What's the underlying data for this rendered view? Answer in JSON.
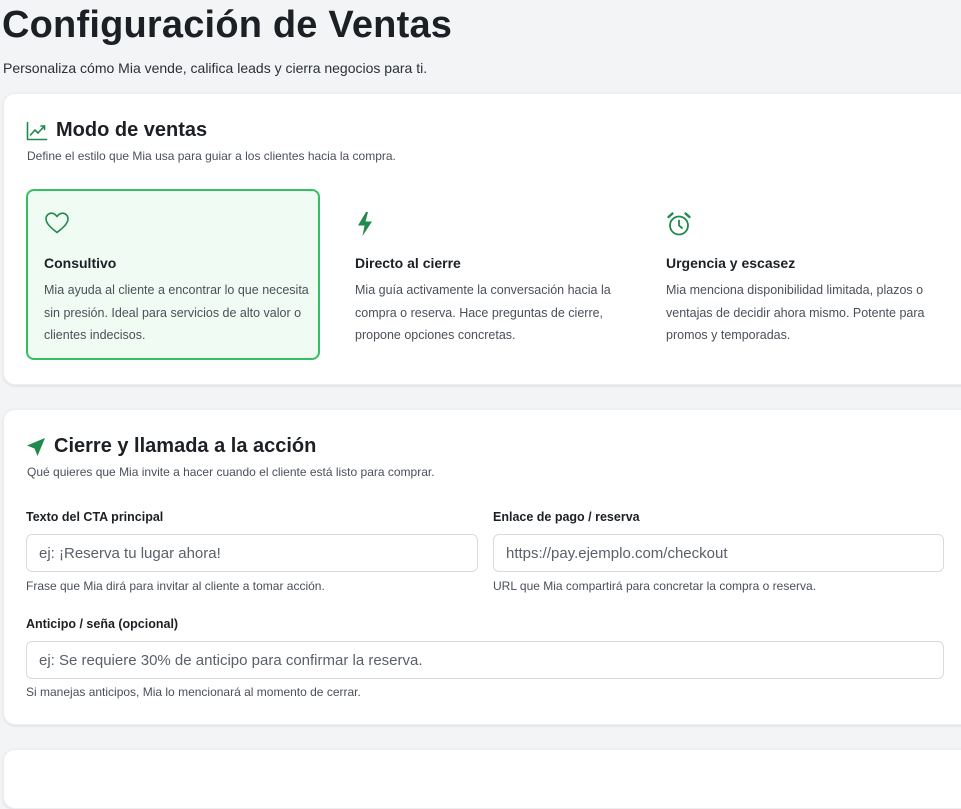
{
  "page": {
    "title": "Configuración de Ventas",
    "subtitle": "Personaliza cómo Mia vende, califica leads y cierra negocios para ti."
  },
  "sales_mode": {
    "icon": "trending-up-icon",
    "title": "Modo de ventas",
    "description": "Define el estilo que Mia usa para guiar a los clientes hacia la compra.",
    "options": [
      {
        "icon": "heart-icon",
        "title": "Consultivo",
        "description": "Mia ayuda al cliente a encontrar lo que necesita sin presión. Ideal para servicios de alto valor o clientes indecisos.",
        "selected": true
      },
      {
        "icon": "lightning-icon",
        "title": "Directo al cierre",
        "description": "Mia guía activamente la conversación hacia la compra o reserva. Hace preguntas de cierre, propone opciones concretas.",
        "selected": false
      },
      {
        "icon": "alarm-clock-icon",
        "title": "Urgencia y escasez",
        "description": "Mia menciona disponibilidad limitada, plazos o ventajas de decidir ahora mismo. Potente para promos y temporadas.",
        "selected": false
      }
    ]
  },
  "closing": {
    "icon": "send-arrow-icon",
    "title": "Cierre y llamada a la acción",
    "description": "Qué quieres que Mia invite a hacer cuando el cliente está listo para comprar.",
    "cta_text": {
      "label": "Texto del CTA principal",
      "value": "",
      "placeholder": "ej: ¡Reserva tu lugar ahora!",
      "help": "Frase que Mia dirá para invitar al cliente a tomar acción."
    },
    "payment_link": {
      "label": "Enlace de pago / reserva",
      "value": "",
      "placeholder": "https://pay.ejemplo.com/checkout",
      "help": "URL que Mia compartirá para concretar la compra o reserva."
    },
    "deposit": {
      "label": "Anticipo / seña (opcional)",
      "value": "",
      "placeholder": "ej: Se requiere 30% de anticipo para confirmar la reserva.",
      "help": "Si manejas anticipos, Mia lo mencionará al momento de cerrar."
    }
  },
  "colors": {
    "accent": "#1e8a4c",
    "selected_border": "#34c062",
    "selected_bg": "#effbf3"
  }
}
